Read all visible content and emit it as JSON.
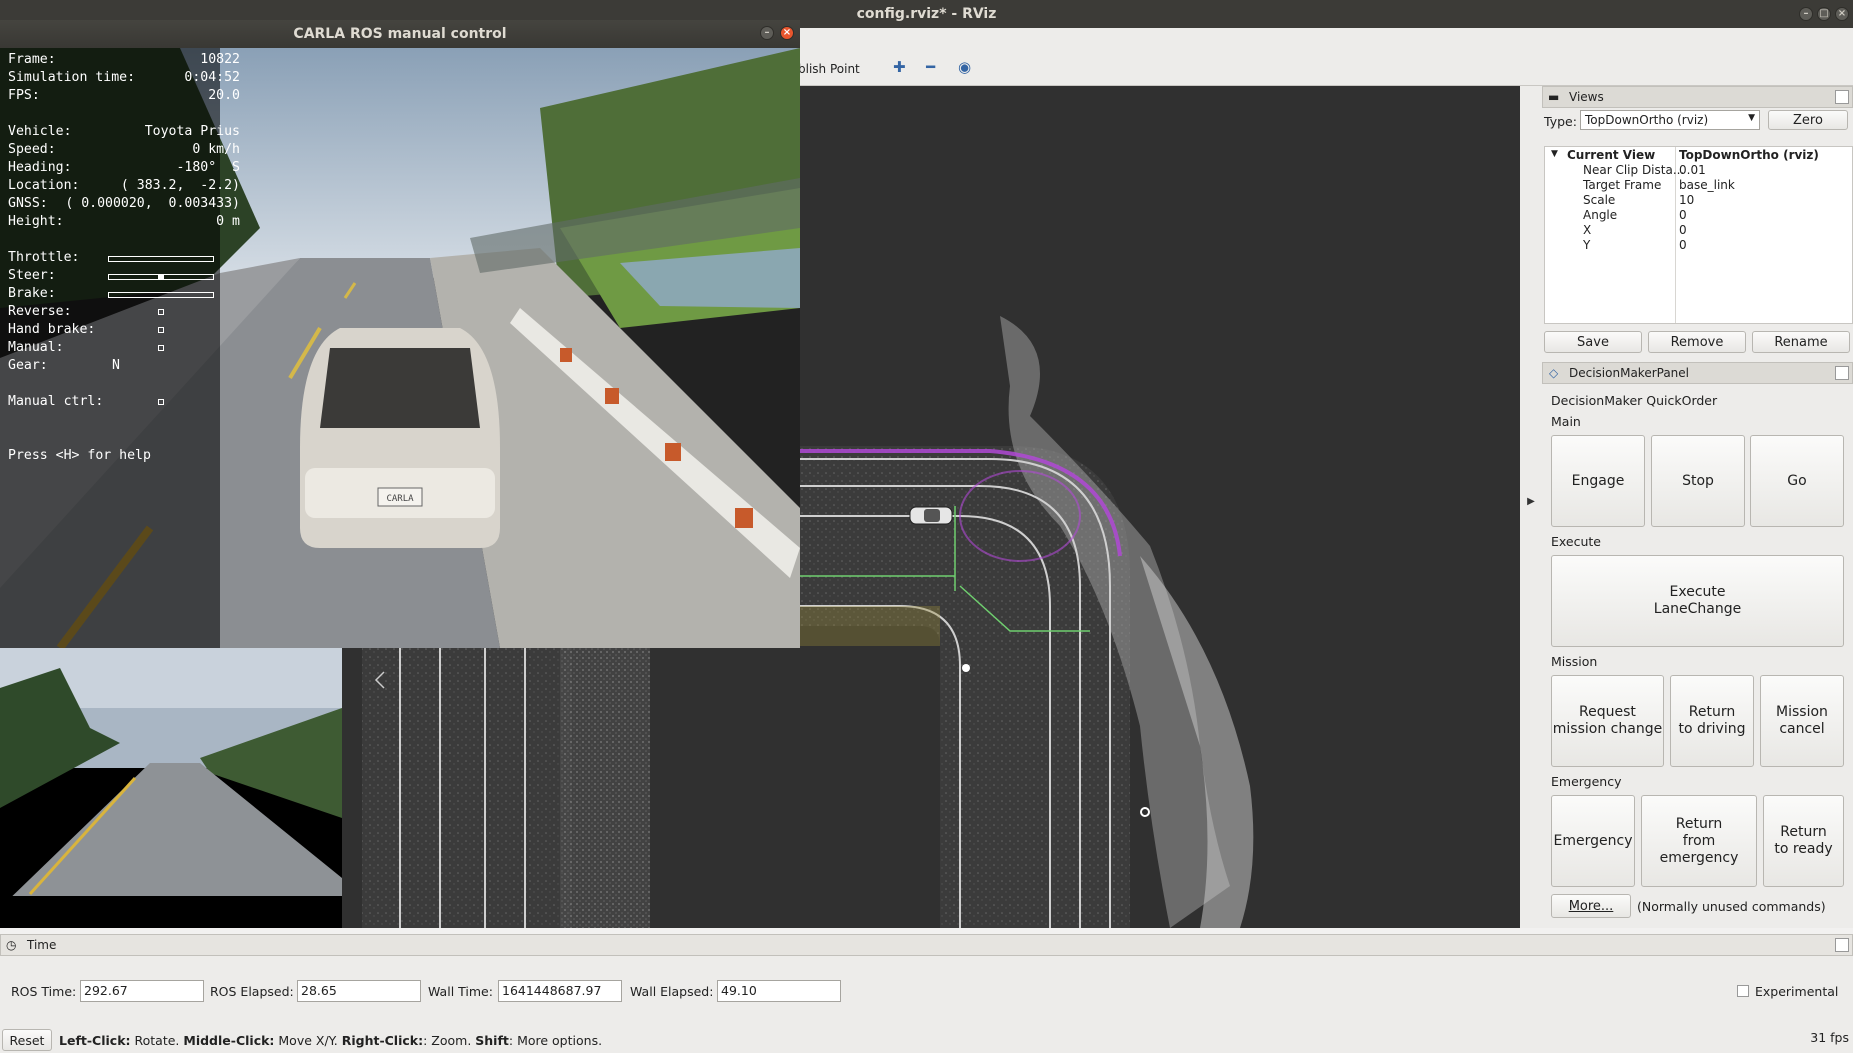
{
  "rviz": {
    "window_title": "config.rviz* - RViz",
    "toolbar": {
      "publish_point_label": "blish Point",
      "tools": [
        "plus-icon",
        "minus-icon",
        "eye-icon"
      ]
    },
    "views": {
      "header": "Views",
      "type_label": "Type:",
      "type_value": "TopDownOrtho (rviz)",
      "zero_label": "Zero",
      "properties": [
        {
          "name": "Current View",
          "value": "TopDownOrtho (rviz)"
        },
        {
          "name": "Near Clip Dista...",
          "value": "0.01"
        },
        {
          "name": "Target Frame",
          "value": "base_link"
        },
        {
          "name": "Scale",
          "value": "10"
        },
        {
          "name": "Angle",
          "value": "0"
        },
        {
          "name": "X",
          "value": "0"
        },
        {
          "name": "Y",
          "value": "0"
        }
      ],
      "save_label": "Save",
      "remove_label": "Remove",
      "rename_label": "Rename"
    },
    "decision_panel": {
      "header": "DecisionMakerPanel",
      "title": "DecisionMaker QuickOrder",
      "main_label": "Main",
      "engage": "Engage",
      "stop": "Stop",
      "go": "Go",
      "execute_label": "Execute",
      "execute_lanechange": "Execute\nLaneChange",
      "mission_label": "Mission",
      "request_mission_change": "Request\nmission change",
      "return_to_driving": "Return\nto driving",
      "mission_cancel": "Mission\ncancel",
      "emergency_label": "Emergency",
      "emergency": "Emergency",
      "return_from_emergency": "Return\nfrom emergency",
      "return_to_ready": "Return\nto ready",
      "more": "More...",
      "more_note": "(Normally unused commands)"
    },
    "time": {
      "header": "Time",
      "ros_time_label": "ROS Time:",
      "ros_time": "292.67",
      "ros_elapsed_label": "ROS Elapsed:",
      "ros_elapsed": "28.65",
      "wall_time_label": "Wall Time:",
      "wall_time": "1641448687.97",
      "wall_elapsed_label": "Wall Elapsed:",
      "wall_elapsed": "49.10",
      "experimental_label": "Experimental"
    },
    "status": {
      "reset": "Reset",
      "help_left": "Left-Click:",
      "help_left_desc": " Rotate. ",
      "help_middle": "Middle-Click:",
      "help_middle_desc": " Move X/Y. ",
      "help_right": "Right-Click:",
      "help_right_desc": ": Zoom. ",
      "help_shift": "Shift",
      "help_shift_desc": ": More options.",
      "fps": "31 fps"
    }
  },
  "carla": {
    "window_title": "CARLA ROS manual control",
    "hud": {
      "frame_label": "Frame:",
      "frame": "10822",
      "sim_time_label": "Simulation time:",
      "sim_time": "0:04:52",
      "fps_label": "FPS:",
      "fps": "20.0",
      "vehicle_label": "Vehicle:",
      "vehicle": "Toyota Prius",
      "speed_label": "Speed:",
      "speed": "0 km/h",
      "heading_label": "Heading:",
      "heading": "-180°  S",
      "location_label": "Location:",
      "location": "( 383.2,  -2.2)",
      "gnss_label": "GNSS:",
      "gnss": "( 0.000020,  0.003433)",
      "height_label": "Height:",
      "height": "0 m",
      "throttle_label": "Throttle:",
      "steer_label": "Steer:",
      "brake_label": "Brake:",
      "reverse_label": "Reverse:",
      "handbrake_label": "Hand brake:",
      "manual_label": "Manual:",
      "gear_label": "Gear:",
      "gear": "N",
      "manual_ctrl_label": "Manual ctrl:",
      "help_hint": "Press <H> for help",
      "throttle": 0.0,
      "steer": 0.5,
      "brake": 0.0
    },
    "plate": "CARLA"
  },
  "colors": {
    "viewport_bg": "#303030",
    "lane_green": "#6fcf6f",
    "trajectory_purple": "#b049d6"
  }
}
